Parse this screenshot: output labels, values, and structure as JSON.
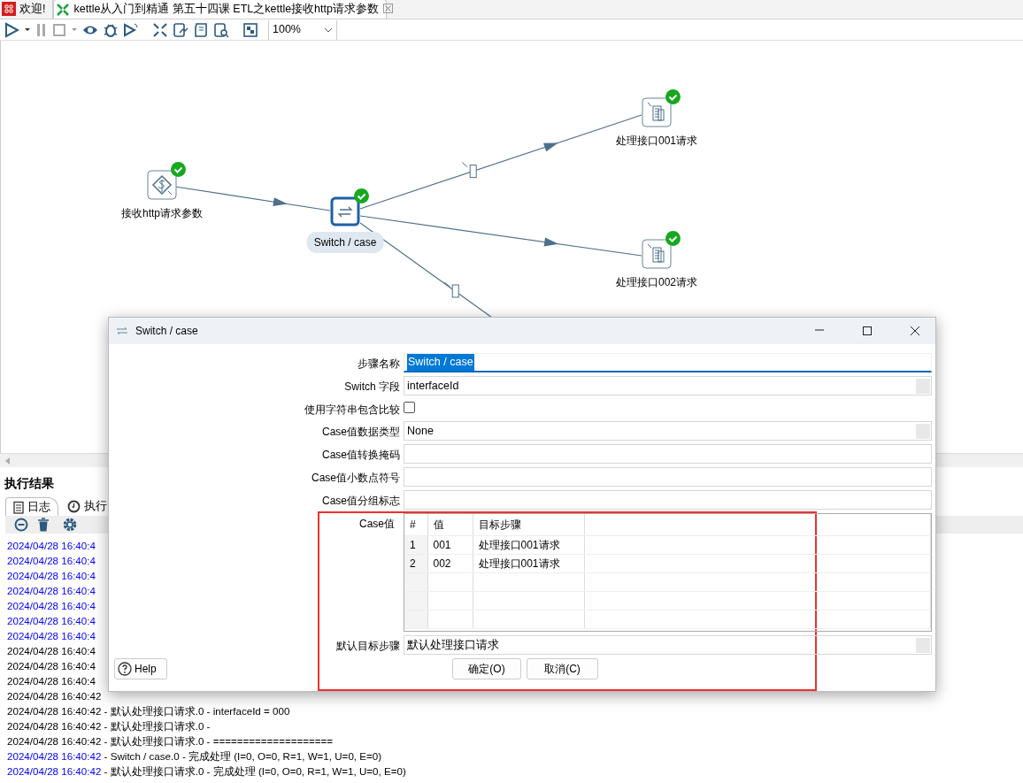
{
  "tabs": [
    {
      "label": "欢迎!",
      "selected": false,
      "kind": "welcome"
    },
    {
      "label": "kettle从入门到精通 第五十四课 ETL之kettle接收http请求参数",
      "selected": true,
      "kind": "transformation"
    }
  ],
  "toolbar": {
    "zoom": "100%"
  },
  "canvas": {
    "steps": [
      {
        "label": "接收http请求参数",
        "kind": "input",
        "selected": false,
        "finished": true
      },
      {
        "label": "Switch / case",
        "kind": "switch",
        "selected": true,
        "finished": true
      },
      {
        "label": "处理接口001请求",
        "kind": "handler",
        "selected": false,
        "finished": true
      },
      {
        "label": "处理接口002请求",
        "kind": "handler",
        "selected": false,
        "finished": true
      }
    ],
    "hops": [
      {
        "target": false
      },
      {
        "target": true
      },
      {
        "target": false
      },
      {
        "target": true
      }
    ]
  },
  "results": {
    "title": "执行结果",
    "tabs": [
      {
        "label": "日志",
        "selected": true
      },
      {
        "label": "执行",
        "selected": false
      }
    ],
    "lines": [
      {
        "time": "2024/04/28 16:40:4",
        "color": "#0000ff"
      },
      {
        "time": "2024/04/28 16:40:4",
        "color": "#0000ff"
      },
      {
        "time": "2024/04/28 16:40:4",
        "color": "#0000ff"
      },
      {
        "time": "2024/04/28 16:40:4",
        "color": "#0000ff"
      },
      {
        "time": "2024/04/28 16:40:4",
        "color": "#0000ff"
      },
      {
        "time": "2024/04/28 16:40:4",
        "color": "#0000ff"
      },
      {
        "time": "2024/04/28 16:40:4",
        "color": "#0000ff"
      },
      {
        "time": "2024/04/28 16:40:4",
        "color": "#000000"
      },
      {
        "time": "2024/04/28 16:40:4",
        "color": "#000000"
      },
      {
        "time": "2024/04/28 16:40:4",
        "color": "#000000"
      },
      {
        "time": "2024/04/28 16:40:42",
        "color": "#000000"
      },
      {
        "time": "2024/04/28 16:40:42",
        "color": "#000000",
        "message": "- 默认处理接口请求.0 - interfaceId = 000"
      },
      {
        "time": "2024/04/28 16:40:42",
        "color": "#000000",
        "message": "- 默认处理接口请求.0 -"
      },
      {
        "time": "2024/04/28 16:40:42",
        "color": "#000000",
        "message": "- 默认处理接口请求.0 - ===================="
      },
      {
        "time": "2024/04/28 16:40:42",
        "color": "#0000ff",
        "message": "- Switch / case.0 - 完成处理 (I=0, O=0, R=1, W=1, U=0, E=0)"
      },
      {
        "time": "2024/04/28 16:40:42",
        "color": "#0000ff",
        "message": "- 默认处理接口请求.0 - 完成处理 (I=0, O=0, R=1, W=1, U=0, E=0)"
      }
    ]
  },
  "dialog": {
    "title": "Switch / case",
    "fields": [
      {
        "label": "步骤名称",
        "value": "Switch / case",
        "kind": "text",
        "focused": true
      },
      {
        "label": "Switch 字段",
        "value": "interfaceId",
        "kind": "combo",
        "focused": false
      },
      {
        "label": "使用字符串包含比较",
        "kind": "checkbox",
        "checked": false
      },
      {
        "label": "Case值数据类型",
        "value": "None",
        "kind": "combo",
        "focused": false
      },
      {
        "label": "Case值转换掩码",
        "kind": "text",
        "focused": false
      },
      {
        "label": "Case值小数点符号",
        "kind": "text",
        "focused": false
      },
      {
        "label": "Case值分组标志",
        "kind": "text",
        "focused": false
      }
    ],
    "case_table": {
      "label": "Case值",
      "columns": [
        "#",
        "值",
        "目标步骤"
      ],
      "rows": [
        [
          "1",
          "001",
          "处理接口001请求"
        ],
        [
          "2",
          "002",
          "处理接口001请求"
        ]
      ]
    },
    "default_target": {
      "label": "默认目标步骤",
      "value": "默认处理接口请求"
    },
    "help": "Help",
    "buttons": [
      "确定(O)",
      "取消(C)"
    ]
  }
}
